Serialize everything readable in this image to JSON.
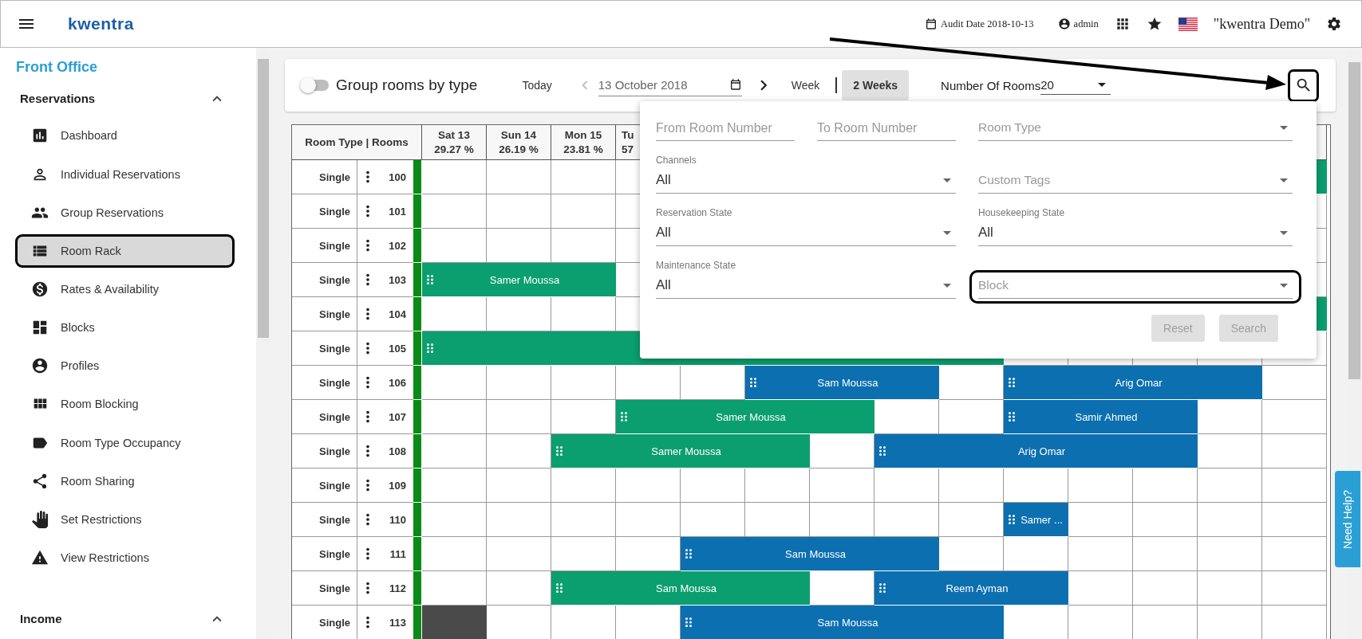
{
  "topbar": {
    "logo": "kwentra",
    "audit_date": "Audit Date 2018-10-13",
    "user": "admin",
    "property": "\"kwentra Demo\""
  },
  "sidebar": {
    "title": "Front Office",
    "sections": [
      {
        "label": "Reservations",
        "expanded": true,
        "items": [
          {
            "label": "Dashboard",
            "selected": false,
            "highlighted": false
          },
          {
            "label": "Individual Reservations",
            "selected": false,
            "highlighted": false
          },
          {
            "label": "Group Reservations",
            "selected": false,
            "highlighted": false
          },
          {
            "label": "Room Rack",
            "selected": true,
            "highlighted": true
          },
          {
            "label": "Rates & Availability",
            "selected": false,
            "highlighted": false
          },
          {
            "label": "Blocks",
            "selected": false,
            "highlighted": false
          },
          {
            "label": "Profiles",
            "selected": false,
            "highlighted": false
          },
          {
            "label": "Room Blocking",
            "selected": false,
            "highlighted": false
          },
          {
            "label": "Room Type Occupancy",
            "selected": false,
            "highlighted": false
          },
          {
            "label": "Room Sharing",
            "selected": false,
            "highlighted": false
          },
          {
            "label": "Set Restrictions",
            "selected": false,
            "highlighted": false
          },
          {
            "label": "View Restrictions",
            "selected": false,
            "highlighted": false
          }
        ]
      },
      {
        "label": "Income",
        "expanded": true
      }
    ]
  },
  "toolbar": {
    "group_toggle": {
      "label": "Group rooms by type",
      "on": false
    },
    "today": "Today",
    "prev_disabled": true,
    "date": "13 October 2018",
    "views": [
      {
        "label": "Week",
        "selected": false
      },
      {
        "label": "2 Weeks",
        "selected": true
      }
    ],
    "rooms_label": "Number Of Rooms",
    "rooms_value": "20",
    "search_highlighted": true
  },
  "filter_panel": {
    "fields": [
      {
        "kind": "text",
        "placeholder": "From Room Number",
        "highlighted": false
      },
      {
        "kind": "text",
        "placeholder": "To Room Number",
        "highlighted": false
      },
      {
        "kind": "select",
        "placeholder": "Room Type",
        "highlighted": false
      },
      {
        "kind": "select",
        "label": "Channels",
        "value": "All",
        "highlighted": false
      },
      {
        "kind": "select",
        "placeholder": "Custom Tags",
        "highlighted": false
      },
      {
        "kind": "select",
        "label": "Reservation State",
        "value": "All",
        "highlighted": false
      },
      {
        "kind": "select",
        "label": "Housekeeping State",
        "value": "All",
        "highlighted": false
      },
      {
        "kind": "select",
        "label": "Maintenance State",
        "value": "All",
        "highlighted": false
      },
      {
        "kind": "select",
        "placeholder": "Block",
        "highlighted": true
      }
    ],
    "buttons": [
      {
        "label": "Reset",
        "disabled": true
      },
      {
        "label": "Search",
        "disabled": true
      }
    ]
  },
  "grid": {
    "corner": "Room Type | Rooms",
    "days": [
      {
        "day": "Sat 13",
        "occupancy": "29.27 %",
        "clipped": false
      },
      {
        "day": "Sun 14",
        "occupancy": "26.19 %",
        "clipped": false
      },
      {
        "day": "Mon 15",
        "occupancy": "23.81 %",
        "clipped": false
      },
      {
        "day": "Tu",
        "occupancy": "57",
        "clipped": true
      }
    ],
    "rows": [
      {
        "type": "Single",
        "number": "100",
        "bookings": [
          {
            "kind": "reservation",
            "color": "#0b9e6e"
          }
        ]
      },
      {
        "type": "Single",
        "number": "101"
      },
      {
        "type": "Single",
        "number": "102"
      },
      {
        "type": "Single",
        "number": "103",
        "bookings": [
          {
            "kind": "reservation",
            "name": "Samer Moussa",
            "color": "#0b9e6e"
          }
        ]
      },
      {
        "type": "Single",
        "number": "104",
        "bookings": [
          {
            "kind": "reservation",
            "color": "#0b9e6e"
          }
        ]
      },
      {
        "type": "Single",
        "number": "105",
        "bookings": [
          {
            "kind": "reservation",
            "color": "#0b9e6e"
          }
        ]
      },
      {
        "type": "Single",
        "number": "106",
        "bookings": [
          {
            "kind": "reservation",
            "name": "Sam Moussa",
            "color": "#0c6fb0"
          },
          {
            "kind": "reservation",
            "name": "Arig Omar",
            "color": "#0c6fb0"
          }
        ]
      },
      {
        "type": "Single",
        "number": "107",
        "bookings": [
          {
            "kind": "reservation",
            "name": "Samer Moussa",
            "color": "#0b9e6e"
          },
          {
            "kind": "reservation",
            "name": "Samir Ahmed",
            "color": "#0c6fb0"
          }
        ]
      },
      {
        "type": "Single",
        "number": "108",
        "bookings": [
          {
            "kind": "reservation",
            "name": "Samer Moussa",
            "color": "#0b9e6e"
          },
          {
            "kind": "reservation",
            "name": "Arig Omar",
            "color": "#0c6fb0"
          }
        ]
      },
      {
        "type": "Single",
        "number": "109"
      },
      {
        "type": "Single",
        "number": "110",
        "bookings": [
          {
            "kind": "reservation",
            "name": "Samer ...",
            "color": "#0c6fb0"
          }
        ]
      },
      {
        "type": "Single",
        "number": "111",
        "bookings": [
          {
            "kind": "reservation",
            "name": "Sam Moussa",
            "color": "#0c6fb0"
          }
        ]
      },
      {
        "type": "Single",
        "number": "112",
        "bookings": [
          {
            "kind": "reservation",
            "name": "Sam Moussa",
            "color": "#0b9e6e"
          },
          {
            "kind": "reservation",
            "name": "Reem Ayman",
            "color": "#0c6fb0"
          }
        ]
      },
      {
        "type": "Single",
        "number": "113",
        "bookings": [
          {
            "kind": "blocked"
          },
          {
            "kind": "reservation",
            "name": "Sam Moussa",
            "color": "#0c6fb0"
          }
        ]
      }
    ]
  },
  "help_tab": "Need Help?"
}
